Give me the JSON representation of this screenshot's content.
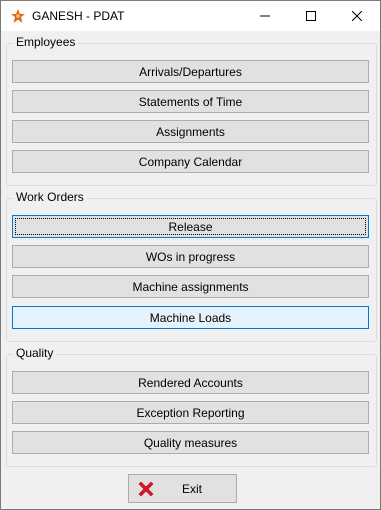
{
  "window": {
    "title": "GANESH - PDAT",
    "icon": "ganesh-app-icon",
    "controls": [
      "minimize-icon",
      "maximize-icon",
      "close-icon"
    ]
  },
  "groups": {
    "employees": {
      "label": "Employees",
      "buttons": [
        "Arrivals/Departures",
        "Statements of Time",
        "Assignments",
        "Company Calendar"
      ]
    },
    "work_orders": {
      "label": "Work Orders",
      "buttons": [
        "Release",
        "WOs in progress",
        "Machine assignments",
        "Machine Loads"
      ]
    },
    "quality": {
      "label": "Quality",
      "buttons": [
        "Rendered Accounts",
        "Exception Reporting",
        "Quality measures"
      ]
    }
  },
  "exit": {
    "label": "Exit",
    "icon": "red-x-icon"
  },
  "colors": {
    "accent": "#0078d7",
    "hover_bg": "#e5f1fb",
    "button_bg": "#e1e1e1",
    "exit_x": "#e81123"
  }
}
